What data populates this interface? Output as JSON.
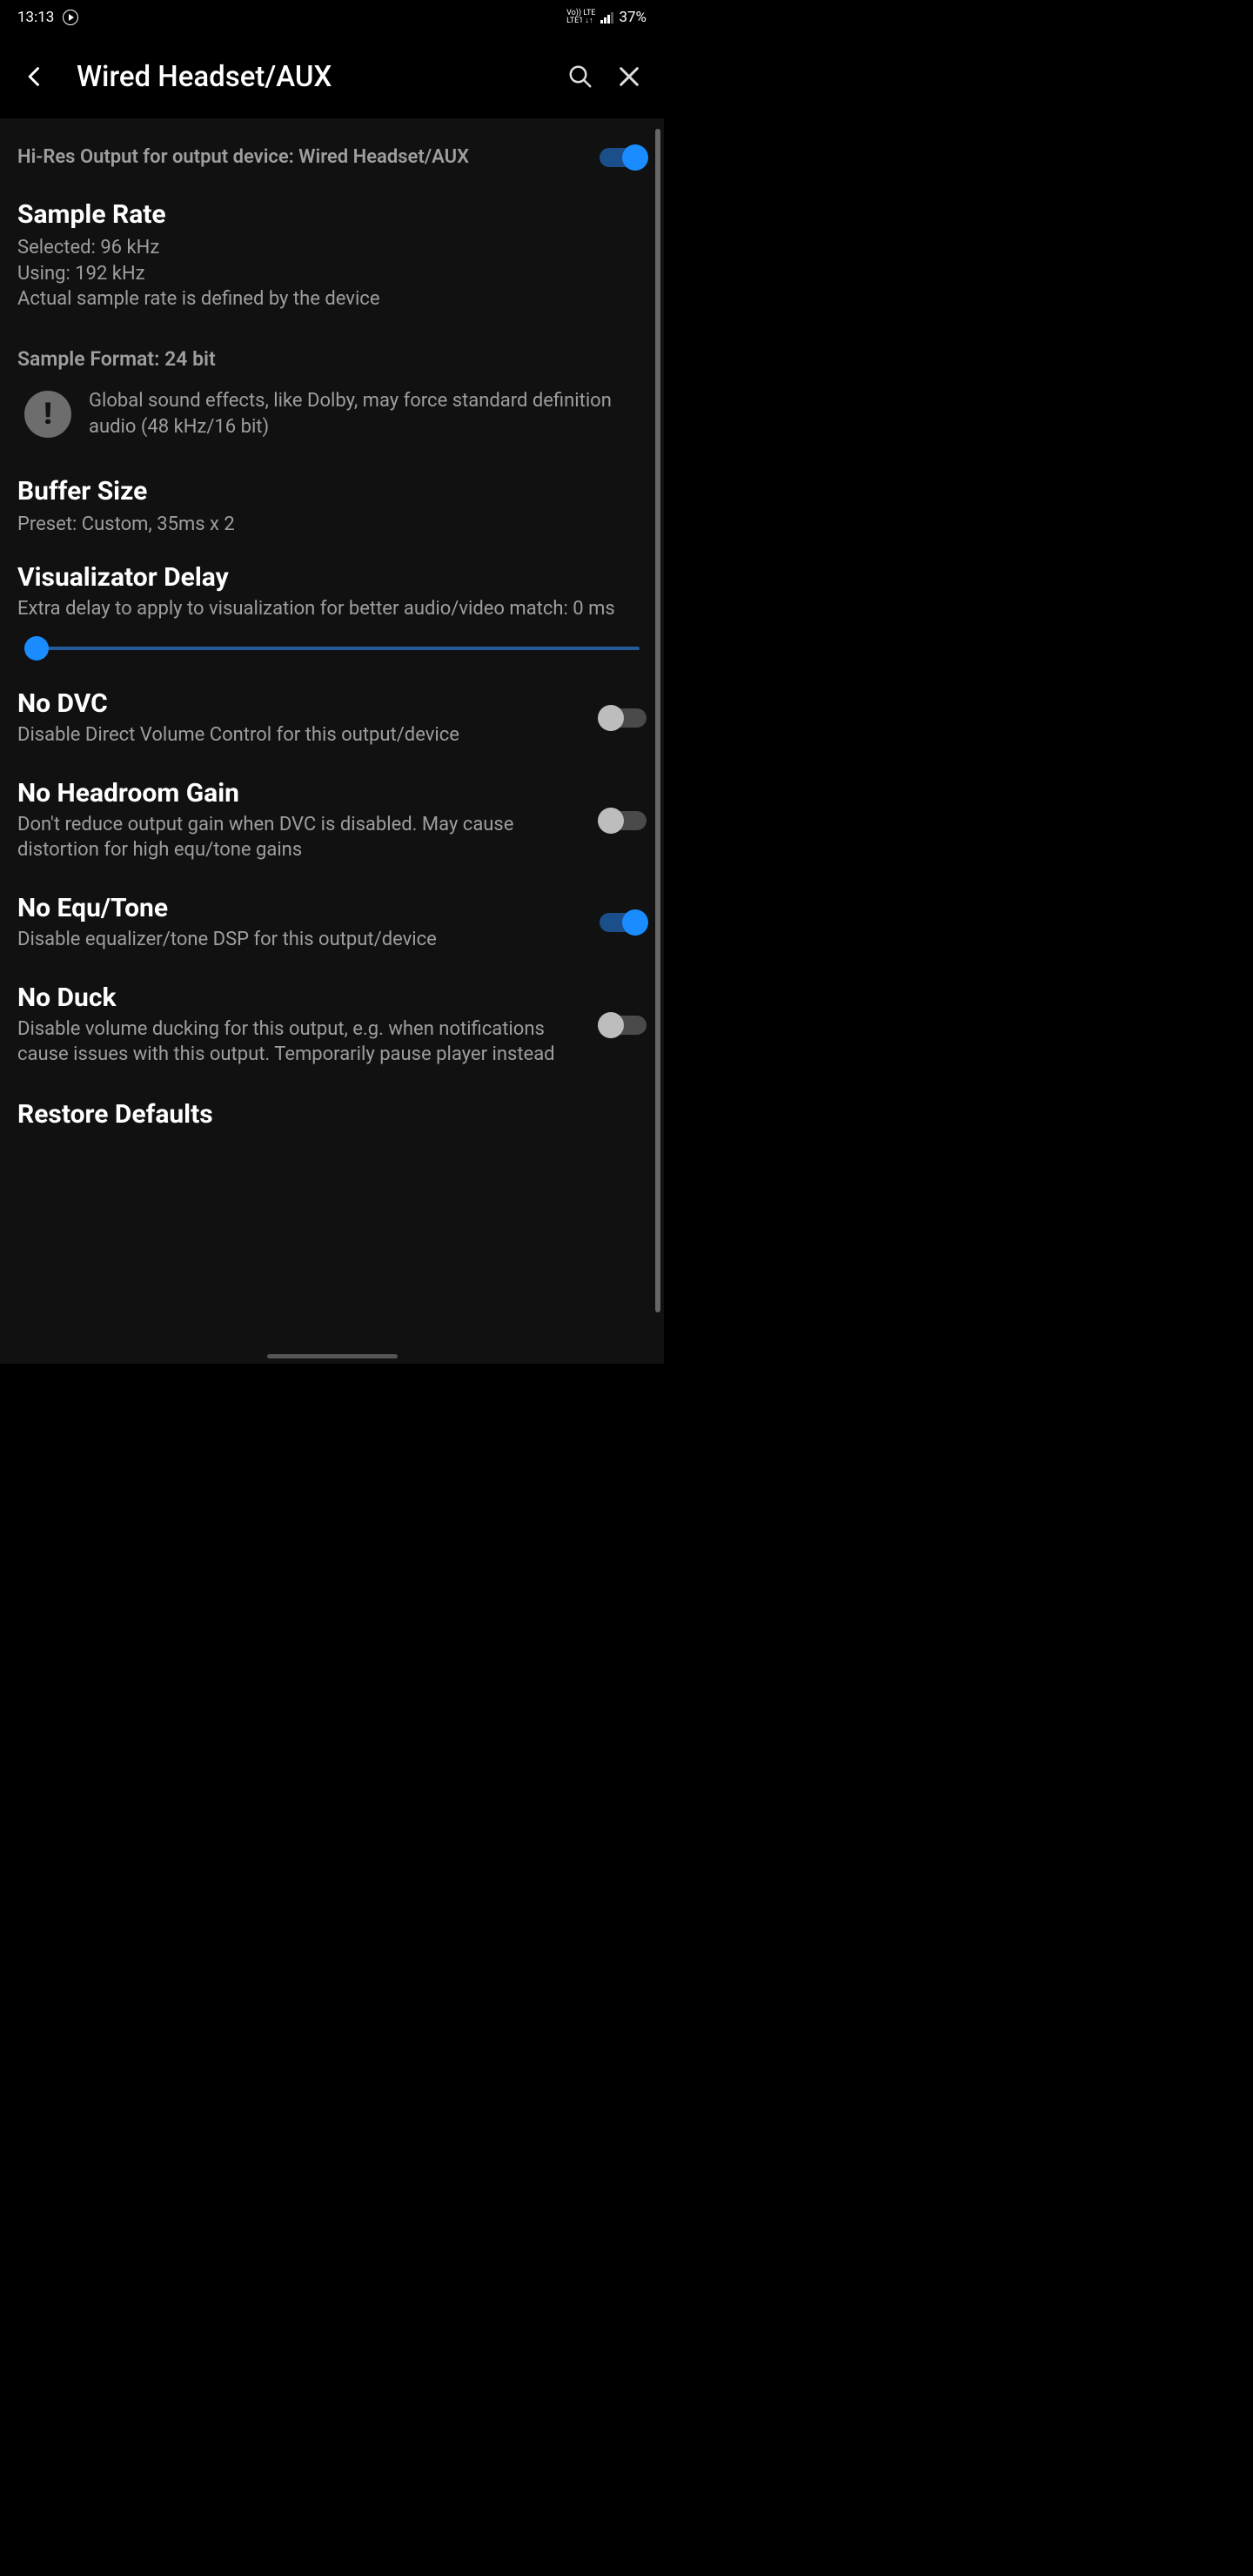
{
  "status": {
    "time": "13:13",
    "network_top": "Vo))  LTE",
    "network_bottom": "LTE1 ↓↑",
    "battery": "37%"
  },
  "appbar": {
    "title": "Wired Headset/AUX"
  },
  "hires": {
    "label": "Hi-Res Output for output device: Wired Headset/AUX"
  },
  "sample_rate": {
    "title": "Sample Rate",
    "line1": "Selected: 96 kHz",
    "line2": "Using: 192 kHz",
    "line3": "Actual sample rate is defined by the device"
  },
  "sample_format": {
    "label": "Sample Format: 24 bit"
  },
  "info": {
    "text": "Global sound effects, like Dolby, may force standard definition audio (48 kHz/16 bit)"
  },
  "buffer": {
    "title": "Buffer Size",
    "sub": "Preset: Custom, 35ms x 2"
  },
  "visualizator": {
    "title": "Visualizator Delay",
    "sub": "Extra delay to apply to visualization for better audio/video match: 0 ms",
    "value_ms": 0
  },
  "no_dvc": {
    "title": "No DVC",
    "sub": "Disable Direct Volume Control for this output/device",
    "enabled": false
  },
  "no_headroom": {
    "title": "No Headroom Gain",
    "sub": "Don't reduce output gain when DVC is disabled. May cause distortion for high equ/tone gains",
    "enabled": false
  },
  "no_equ": {
    "title": "No Equ/Tone",
    "sub": "Disable equalizer/tone DSP for this output/device",
    "enabled": true
  },
  "no_duck": {
    "title": "No Duck",
    "sub": "Disable volume ducking for this output, e.g. when notifications cause issues with this output. Temporarily pause player instead",
    "enabled": false
  },
  "restore": {
    "title": "Restore Defaults"
  }
}
